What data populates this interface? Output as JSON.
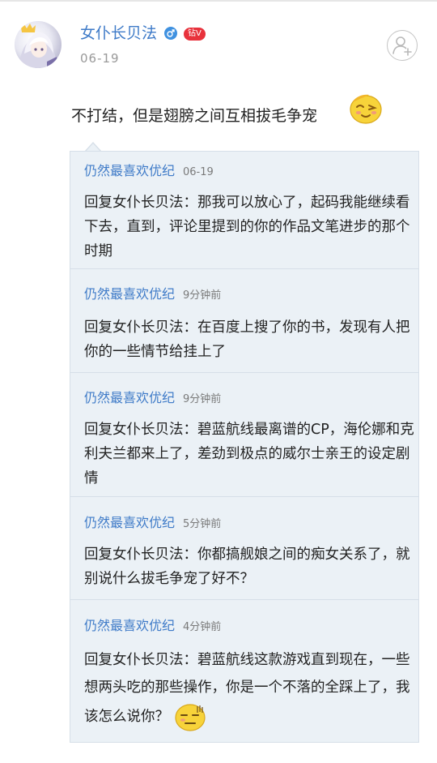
{
  "post": {
    "author": {
      "name": "女仆长贝法",
      "gender_icon": "male-icon",
      "badge": "钻V",
      "avatar_icon": "anime-avatar"
    },
    "date": "06-19",
    "content": "不打结，但是翅膀之间互相拔毛争宠",
    "content_emoji": "wink-emoji",
    "follow_icon": "add-user-icon"
  },
  "replies": [
    {
      "user": "仍然最喜欢优纪",
      "time": "06-19",
      "text": "回复女仆长贝法：那我可以放心了，起码我能继续看下去，直到，评论里提到的你的作品文笔进步的那个时期"
    },
    {
      "user": "仍然最喜欢优纪",
      "time": "9分钟前",
      "text": "回复女仆长贝法：在百度上搜了你的书，发现有人把你的一些情节给挂上了"
    },
    {
      "user": "仍然最喜欢优纪",
      "time": "9分钟前",
      "text": "回复女仆长贝法：碧蓝航线最离谱的CP，海伦娜和克利夫兰都来上了，差劲到极点的威尔士亲王的设定剧情"
    },
    {
      "user": "仍然最喜欢优纪",
      "time": "5分钟前",
      "text": "回复女仆长贝法：你都搞舰娘之间的痴女关系了，就别说什么拔毛争宠了好不？"
    },
    {
      "user": "仍然最喜欢优纪",
      "time": "4分钟前",
      "text": "回复女仆长贝法：碧蓝航线这款游戏直到现在，一些想两头吃的那些操作，你是一个不落的全踩上了，我该怎么说你？",
      "emoji": "awkward-emoji"
    }
  ],
  "colors": {
    "link_blue": "#3f7bc8",
    "reply_bg": "#ebf1f6",
    "badge_red": "#e8323c",
    "muted_gray": "#999999"
  }
}
